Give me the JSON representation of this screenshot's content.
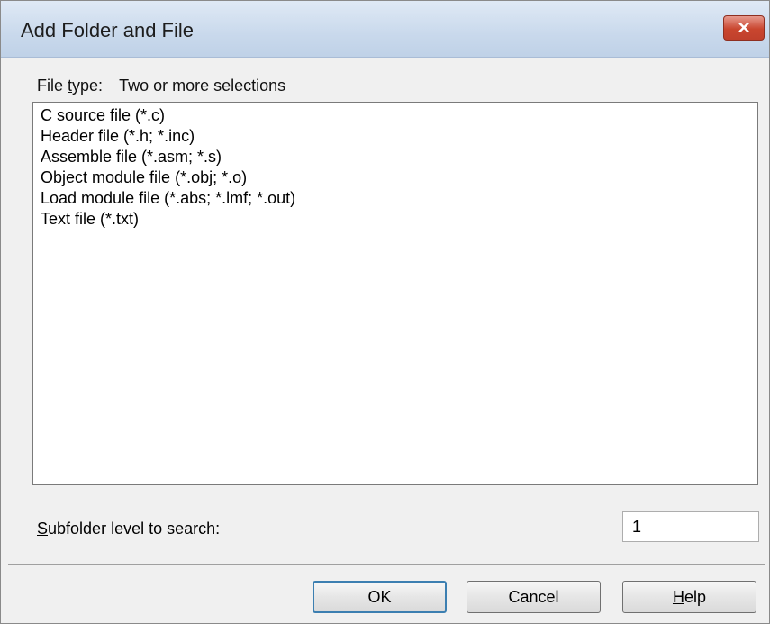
{
  "window": {
    "title": "Add Folder and File",
    "close_glyph": "✕"
  },
  "file_type": {
    "label_prefix": "File ",
    "label_mnemonic": "t",
    "label_suffix": "ype:",
    "value": "Two or more selections"
  },
  "file_types": [
    "C source file (*.c)",
    "Header file (*.h; *.inc)",
    "Assemble file (*.asm; *.s)",
    "Object module file (*.obj; *.o)",
    "Load module file (*.abs; *.lmf; *.out)",
    "Text file (*.txt)"
  ],
  "subfolder": {
    "label_mnemonic": "S",
    "label_rest": "ubfolder level to search:",
    "value": "1"
  },
  "buttons": {
    "ok": "OK",
    "cancel": "Cancel",
    "help_mnemonic": "H",
    "help_rest": "elp"
  }
}
